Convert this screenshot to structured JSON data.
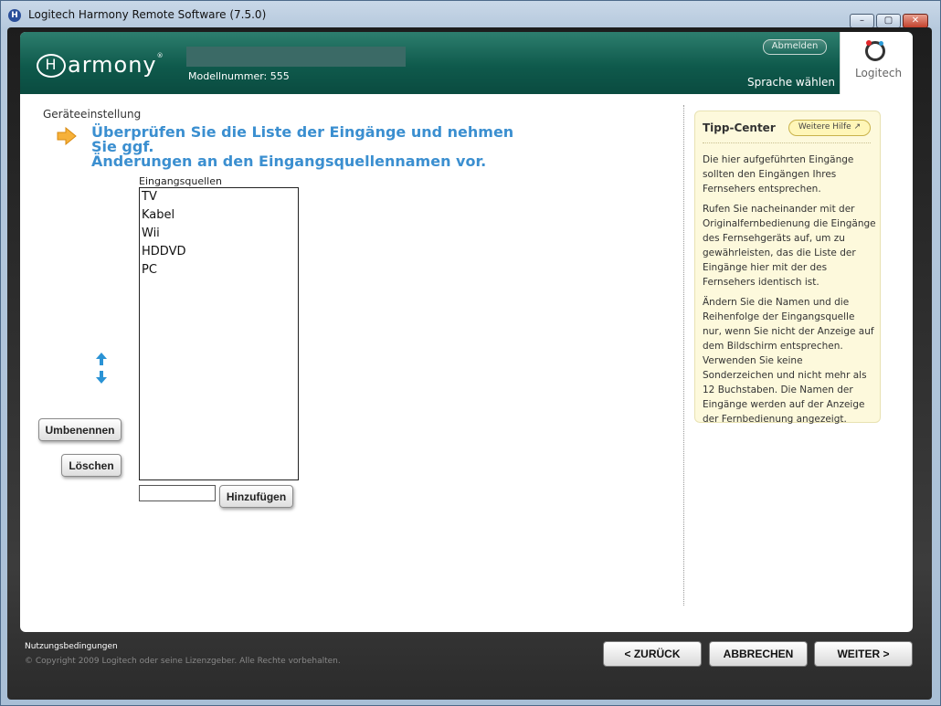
{
  "window": {
    "title": "Logitech Harmony Remote Software (7.5.0)"
  },
  "header": {
    "logo": "Harmony",
    "model_label": "Modellnummer: 555",
    "logout": "Abmelden",
    "language": "Sprache wählen",
    "brand": "Logitech"
  },
  "main": {
    "section": "Geräteeinstellung",
    "headline_line1": "Überprüfen Sie die Liste der Eingänge und nehmen Sie ggf.",
    "headline_line2": "Änderungen an den Eingangsquellennamen vor.",
    "list_caption": "Eingangsquellen",
    "inputs": [
      "TV",
      "Kabel",
      "Wii",
      "HDDVD",
      "PC"
    ],
    "rename": "Umbenennen",
    "delete": "Löschen",
    "add": "Hinzufügen",
    "add_value": ""
  },
  "tip": {
    "title": "Tipp-Center",
    "more_help": "Weitere Hilfe",
    "p1": "Die hier aufgeführten Eingänge sollten den Eingängen Ihres Fernsehers entsprechen.",
    "p2": "Rufen Sie nacheinander mit der Originalfernbedienung die Eingänge des Fernsehgeräts auf, um zu gewährleisten, das die Liste der Eingänge hier mit der des Fernsehers identisch ist.",
    "p3": "Ändern Sie die Namen und die Reihenfolge der Eingangsquelle nur, wenn Sie nicht der Anzeige auf dem Bildschirm entsprechen. Verwenden Sie keine Sonderzeichen und nicht mehr als 12 Buchstaben. Die Namen der Eingänge werden auf der Anzeige der Fernbedienung angezeigt."
  },
  "footer": {
    "terms": "Nutzungsbedingungen",
    "copyright": "© Copyright 2009 Logitech oder seine Lizenzgeber. Alle Rechte vorbehalten.",
    "back": "< ZURÜCK",
    "cancel": "ABBRECHEN",
    "next": "WEITER >"
  },
  "colors": {
    "accent": "#3b8fd0",
    "header": "#0f5a4c",
    "tip_bg": "#fdf9dc"
  }
}
